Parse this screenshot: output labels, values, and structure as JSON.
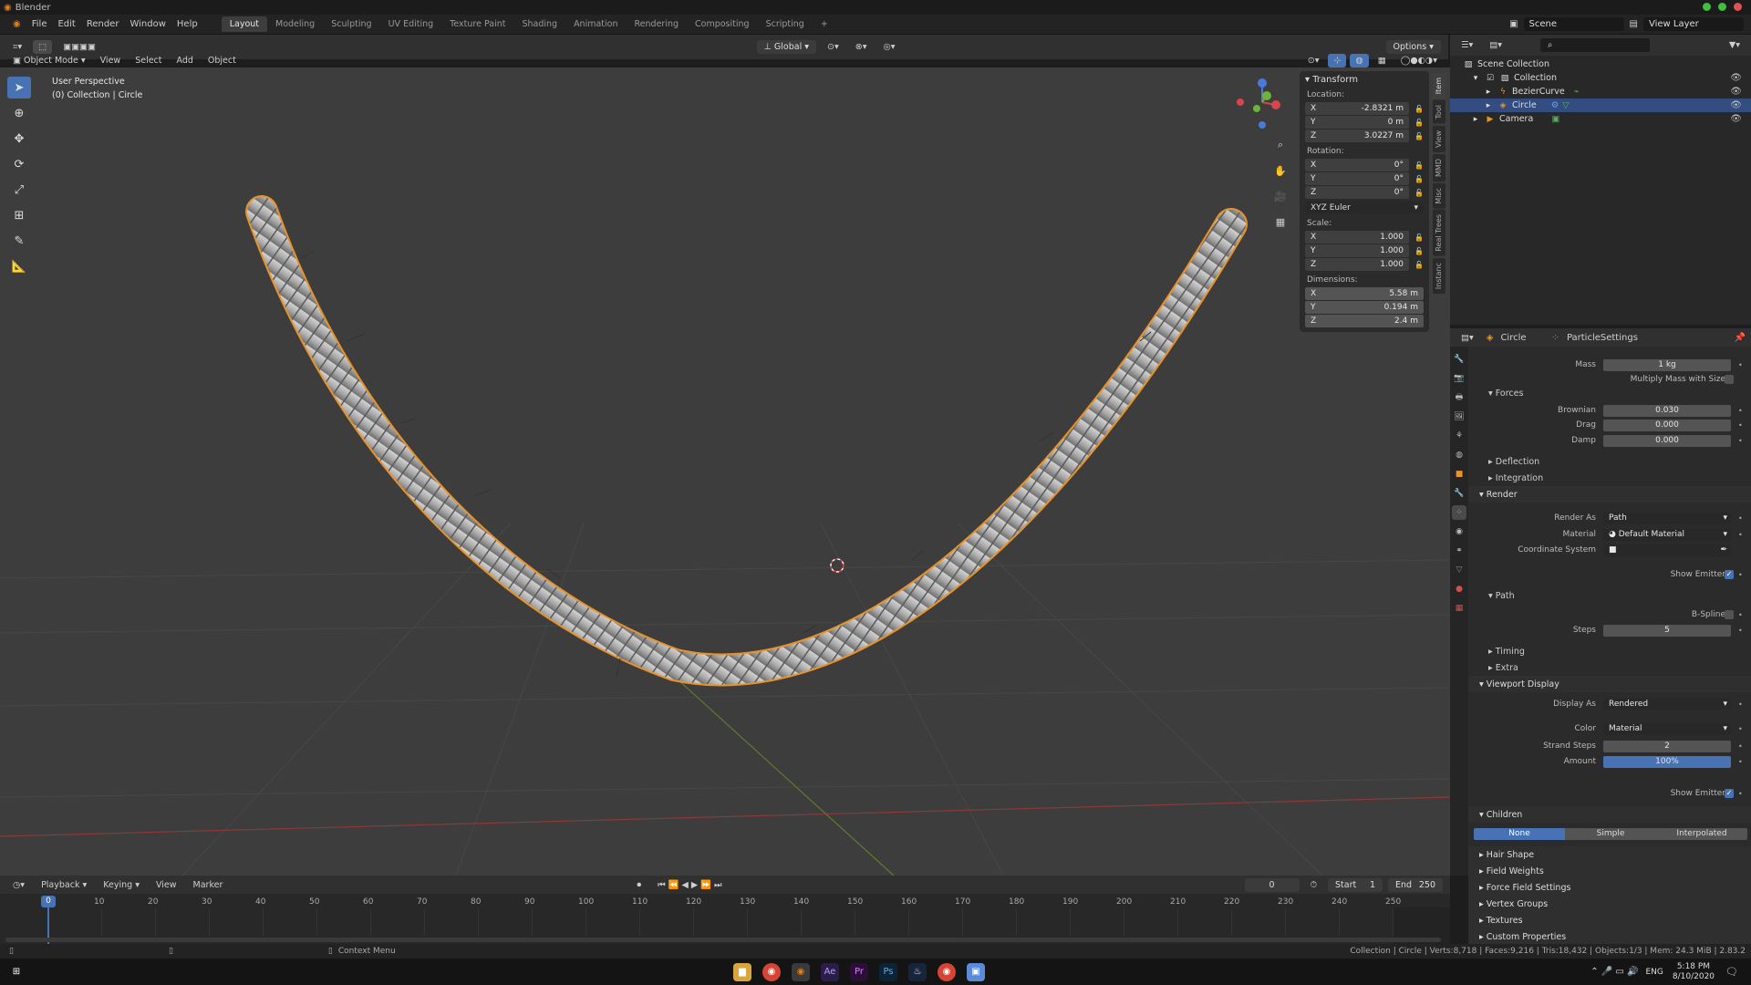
{
  "app": {
    "title": "Blender"
  },
  "menu": [
    "File",
    "Edit",
    "Render",
    "Window",
    "Help"
  ],
  "workspaces": [
    "Layout",
    "Modeling",
    "Sculpting",
    "UV Editing",
    "Texture Paint",
    "Shading",
    "Animation",
    "Rendering",
    "Compositing",
    "Scripting",
    "+"
  ],
  "top_right": {
    "scene": "Scene",
    "view_layer": "View Layer"
  },
  "viewport_header": {
    "mode": "Object Mode",
    "menus": [
      "View",
      "Select",
      "Add",
      "Object"
    ],
    "orientation": "Global",
    "options": "Options"
  },
  "viewport_overlay": {
    "line1": "User Perspective",
    "line2": "(0) Collection | Circle"
  },
  "npanel": {
    "header": "Transform",
    "location_label": "Location:",
    "location": [
      {
        "axis": "X",
        "value": "-2.8321 m"
      },
      {
        "axis": "Y",
        "value": "0 m"
      },
      {
        "axis": "Z",
        "value": "3.0227 m"
      }
    ],
    "rotation_label": "Rotation:",
    "rotation": [
      {
        "axis": "X",
        "value": "0°"
      },
      {
        "axis": "Y",
        "value": "0°"
      },
      {
        "axis": "Z",
        "value": "0°"
      }
    ],
    "rotation_mode": "XYZ Euler",
    "scale_label": "Scale:",
    "scale": [
      {
        "axis": "X",
        "value": "1.000"
      },
      {
        "axis": "Y",
        "value": "1.000"
      },
      {
        "axis": "Z",
        "value": "1.000"
      }
    ],
    "dimensions_label": "Dimensions:",
    "dimensions": [
      {
        "axis": "X",
        "value": "5.58 m"
      },
      {
        "axis": "Y",
        "value": "0.194 m"
      },
      {
        "axis": "Z",
        "value": "2.4 m"
      }
    ],
    "tabs": [
      "Item",
      "Tool",
      "View",
      "MMD",
      "Misc",
      "Real Trees",
      "Instanc"
    ]
  },
  "outliner": {
    "root": "Scene Collection",
    "items": [
      {
        "label": "Collection"
      },
      {
        "label": "BezierCurve"
      },
      {
        "label": "Circle"
      },
      {
        "label": "Camera"
      }
    ]
  },
  "properties": {
    "breadcrumb": [
      "Circle",
      "ParticleSettings"
    ],
    "mass_label": "Mass",
    "mass": "1 kg",
    "multiply_mass": "Multiply Mass with Size",
    "forces": "Forces",
    "brownian_label": "Brownian",
    "brownian": "0.030",
    "drag_label": "Drag",
    "drag": "0.000",
    "damp_label": "Damp",
    "damp": "0.000",
    "deflection": "Deflection",
    "integration": "Integration",
    "render": "Render",
    "render_as_label": "Render As",
    "render_as": "Path",
    "material_label": "Material",
    "material": "Default Material",
    "coord_label": "Coordinate System",
    "show_emitter": "Show Emitter",
    "path": "Path",
    "bspline": "B-Spline",
    "steps_label": "Steps",
    "steps": "5",
    "timing": "Timing",
    "extra": "Extra",
    "viewport_display": "Viewport Display",
    "display_as_label": "Display As",
    "display_as": "Rendered",
    "color_label": "Color",
    "color": "Material",
    "strand_steps_label": "Strand Steps",
    "strand_steps": "2",
    "amount_label": "Amount",
    "amount": "100%",
    "amount_fraction": 1.0,
    "show_emitter2": "Show Emitter",
    "children": "Children",
    "children_opts": [
      "None",
      "Simple",
      "Interpolated"
    ],
    "collapsed": [
      "Hair Shape",
      "Field Weights",
      "Force Field Settings",
      "Vertex Groups",
      "Textures",
      "Custom Properties"
    ]
  },
  "timeline": {
    "menus": [
      "Playback",
      "Keying",
      "View",
      "Marker"
    ],
    "current": "0",
    "start_label": "Start",
    "start": "1",
    "end_label": "End",
    "end": "250",
    "marker": "0",
    "frames": [
      "10",
      "20",
      "30",
      "40",
      "50",
      "60",
      "70",
      "80",
      "90",
      "100",
      "110",
      "120",
      "130",
      "140",
      "150",
      "160",
      "170",
      "180",
      "190",
      "200",
      "210",
      "220",
      "230",
      "240",
      "250"
    ]
  },
  "statusbar": {
    "context": "Context Menu",
    "stats": "Collection | Circle | Verts:8,718 | Faces:9,216 | Tris:18,432 | Objects:1/3 | Mem: 24.3 MiB | 2.83.2"
  },
  "taskbar": {
    "lang": "ENG",
    "time": "5:18 PM",
    "date": "8/10/2020"
  },
  "colors": {
    "accent": "#4772b3",
    "selection": "#e8932a",
    "viewport": "#3d3d3d"
  }
}
